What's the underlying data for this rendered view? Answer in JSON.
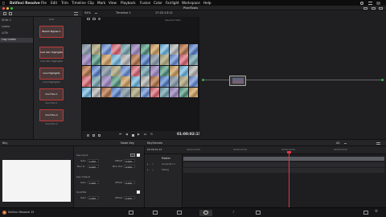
{
  "menubar": {
    "apple": "",
    "items": [
      "DaVinci Resolve",
      "File",
      "Edit",
      "Trim",
      "Timeline",
      "Clip",
      "Mark",
      "View",
      "Playback",
      "Fusion",
      "Color",
      "Fairlight",
      "Workspace",
      "Help"
    ]
  },
  "topbar": {
    "app_title": "PixelTools"
  },
  "viewer": {
    "zoom": "54%",
    "timeline_name": "Timeline 1",
    "timecode": "17:22:13:11",
    "clip_label": "Selected Stills"
  },
  "transport": {
    "timecode": "01:00:02:15"
  },
  "gallery_tree": {
    "items": [
      "Stills 1",
      "Looks",
      "LUTs",
      "Log Looks"
    ]
  },
  "gallery_thumbs": [
    {
      "caption": "Bleach Bypass 1",
      "label": "Look"
    },
    {
      "caption": "Cool Skin Highlights",
      "label": "Cool Skin Highlights"
    },
    {
      "caption": "Cool Highlights",
      "label": "Cool Highlights"
    },
    {
      "caption": "Cool Hue 1",
      "label": "Cool Hue 1"
    },
    {
      "caption": "Cool Hue 2",
      "label": "Cool Hue 2"
    }
  ],
  "key_panel": {
    "title": "Key"
  },
  "params_panel": {
    "title": "Node Key",
    "key_input": {
      "label": "Key Input",
      "gain_label": "Gain",
      "gain": "1.000",
      "offset_label": "Offset",
      "offset": "0.000",
      "blur_r_label": "Blur R.",
      "blur_r": "0.000",
      "blur_hv_label": "Blur H/V",
      "blur_hv": "0.000"
    },
    "key_output": {
      "label": "Key Output",
      "gain_label": "Gain",
      "gain": "1.000",
      "offset_label": "Offset",
      "offset": "0.000"
    },
    "qualifier": {
      "label": "Qualifier",
      "gain_label": "Gain",
      "gain": "1.000",
      "offset_label": "Offset",
      "offset": "0.000"
    }
  },
  "keyframes": {
    "title": "Keyframes",
    "timecode": "00:00:01:13",
    "filter": "All",
    "ruler": [
      "00:00:00:00",
      "00:00:01:00",
      "00:00:02:00",
      "00:00:03:00"
    ],
    "tracks": [
      "Master",
      "Corrector 1",
      "Sizing"
    ]
  },
  "statusbar": {
    "app_name": "DaVinci Resolve 15"
  },
  "colors": {
    "playhead": "#e0384a",
    "accent": "#e0384a",
    "thumb_border": "#c03a3a"
  }
}
